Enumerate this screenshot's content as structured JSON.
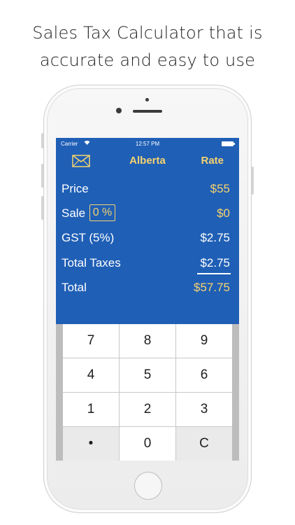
{
  "headline": {
    "line1": "Sales Tax Calculator that is",
    "line2": "accurate and easy to use"
  },
  "status_bar": {
    "carrier": "Carrier",
    "time": "12:57 PM"
  },
  "nav": {
    "title": "Alberta",
    "rate_label": "Rate",
    "mail_icon": "mail-icon"
  },
  "rows": {
    "price": {
      "label": "Price",
      "value": "$55"
    },
    "sale": {
      "label": "Sale",
      "percent": "0 %",
      "value": "$0"
    },
    "gst": {
      "label": "GST (5%)",
      "value": "$2.75"
    },
    "total_taxes": {
      "label": "Total Taxes",
      "value": "$2.75"
    },
    "total": {
      "label": "Total",
      "value": "$57.75"
    }
  },
  "keypad": {
    "keys": [
      "7",
      "8",
      "9",
      "4",
      "5",
      "6",
      "1",
      "2",
      "3",
      "•",
      "0",
      "C"
    ]
  },
  "colors": {
    "screen_bg": "#1f5fb6",
    "accent_gold": "#f6d36f"
  }
}
